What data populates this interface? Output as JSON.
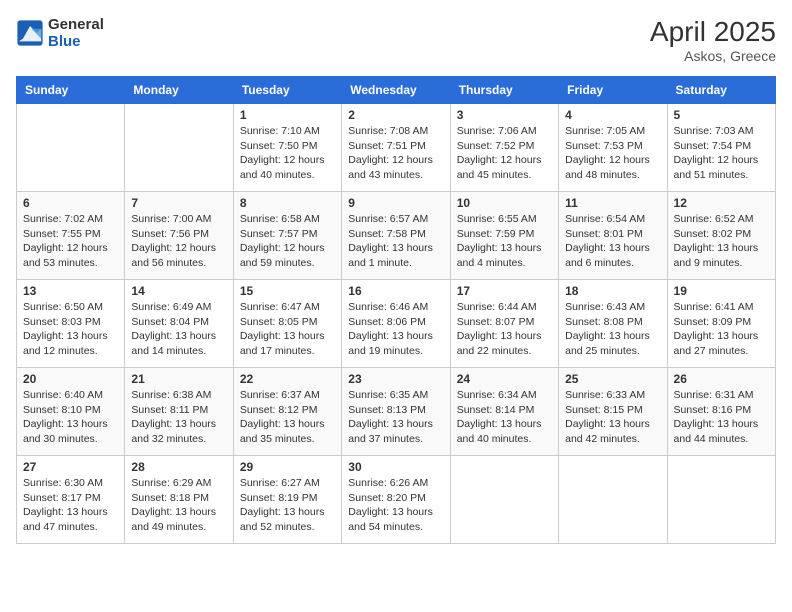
{
  "header": {
    "logo_line1": "General",
    "logo_line2": "Blue",
    "month_year": "April 2025",
    "location": "Askos, Greece"
  },
  "weekdays": [
    "Sunday",
    "Monday",
    "Tuesday",
    "Wednesday",
    "Thursday",
    "Friday",
    "Saturday"
  ],
  "weeks": [
    [
      {
        "day": "",
        "info": ""
      },
      {
        "day": "",
        "info": ""
      },
      {
        "day": "1",
        "info": "Sunrise: 7:10 AM\nSunset: 7:50 PM\nDaylight: 12 hours and 40 minutes."
      },
      {
        "day": "2",
        "info": "Sunrise: 7:08 AM\nSunset: 7:51 PM\nDaylight: 12 hours and 43 minutes."
      },
      {
        "day": "3",
        "info": "Sunrise: 7:06 AM\nSunset: 7:52 PM\nDaylight: 12 hours and 45 minutes."
      },
      {
        "day": "4",
        "info": "Sunrise: 7:05 AM\nSunset: 7:53 PM\nDaylight: 12 hours and 48 minutes."
      },
      {
        "day": "5",
        "info": "Sunrise: 7:03 AM\nSunset: 7:54 PM\nDaylight: 12 hours and 51 minutes."
      }
    ],
    [
      {
        "day": "6",
        "info": "Sunrise: 7:02 AM\nSunset: 7:55 PM\nDaylight: 12 hours and 53 minutes."
      },
      {
        "day": "7",
        "info": "Sunrise: 7:00 AM\nSunset: 7:56 PM\nDaylight: 12 hours and 56 minutes."
      },
      {
        "day": "8",
        "info": "Sunrise: 6:58 AM\nSunset: 7:57 PM\nDaylight: 12 hours and 59 minutes."
      },
      {
        "day": "9",
        "info": "Sunrise: 6:57 AM\nSunset: 7:58 PM\nDaylight: 13 hours and 1 minute."
      },
      {
        "day": "10",
        "info": "Sunrise: 6:55 AM\nSunset: 7:59 PM\nDaylight: 13 hours and 4 minutes."
      },
      {
        "day": "11",
        "info": "Sunrise: 6:54 AM\nSunset: 8:01 PM\nDaylight: 13 hours and 6 minutes."
      },
      {
        "day": "12",
        "info": "Sunrise: 6:52 AM\nSunset: 8:02 PM\nDaylight: 13 hours and 9 minutes."
      }
    ],
    [
      {
        "day": "13",
        "info": "Sunrise: 6:50 AM\nSunset: 8:03 PM\nDaylight: 13 hours and 12 minutes."
      },
      {
        "day": "14",
        "info": "Sunrise: 6:49 AM\nSunset: 8:04 PM\nDaylight: 13 hours and 14 minutes."
      },
      {
        "day": "15",
        "info": "Sunrise: 6:47 AM\nSunset: 8:05 PM\nDaylight: 13 hours and 17 minutes."
      },
      {
        "day": "16",
        "info": "Sunrise: 6:46 AM\nSunset: 8:06 PM\nDaylight: 13 hours and 19 minutes."
      },
      {
        "day": "17",
        "info": "Sunrise: 6:44 AM\nSunset: 8:07 PM\nDaylight: 13 hours and 22 minutes."
      },
      {
        "day": "18",
        "info": "Sunrise: 6:43 AM\nSunset: 8:08 PM\nDaylight: 13 hours and 25 minutes."
      },
      {
        "day": "19",
        "info": "Sunrise: 6:41 AM\nSunset: 8:09 PM\nDaylight: 13 hours and 27 minutes."
      }
    ],
    [
      {
        "day": "20",
        "info": "Sunrise: 6:40 AM\nSunset: 8:10 PM\nDaylight: 13 hours and 30 minutes."
      },
      {
        "day": "21",
        "info": "Sunrise: 6:38 AM\nSunset: 8:11 PM\nDaylight: 13 hours and 32 minutes."
      },
      {
        "day": "22",
        "info": "Sunrise: 6:37 AM\nSunset: 8:12 PM\nDaylight: 13 hours and 35 minutes."
      },
      {
        "day": "23",
        "info": "Sunrise: 6:35 AM\nSunset: 8:13 PM\nDaylight: 13 hours and 37 minutes."
      },
      {
        "day": "24",
        "info": "Sunrise: 6:34 AM\nSunset: 8:14 PM\nDaylight: 13 hours and 40 minutes."
      },
      {
        "day": "25",
        "info": "Sunrise: 6:33 AM\nSunset: 8:15 PM\nDaylight: 13 hours and 42 minutes."
      },
      {
        "day": "26",
        "info": "Sunrise: 6:31 AM\nSunset: 8:16 PM\nDaylight: 13 hours and 44 minutes."
      }
    ],
    [
      {
        "day": "27",
        "info": "Sunrise: 6:30 AM\nSunset: 8:17 PM\nDaylight: 13 hours and 47 minutes."
      },
      {
        "day": "28",
        "info": "Sunrise: 6:29 AM\nSunset: 8:18 PM\nDaylight: 13 hours and 49 minutes."
      },
      {
        "day": "29",
        "info": "Sunrise: 6:27 AM\nSunset: 8:19 PM\nDaylight: 13 hours and 52 minutes."
      },
      {
        "day": "30",
        "info": "Sunrise: 6:26 AM\nSunset: 8:20 PM\nDaylight: 13 hours and 54 minutes."
      },
      {
        "day": "",
        "info": ""
      },
      {
        "day": "",
        "info": ""
      },
      {
        "day": "",
        "info": ""
      }
    ]
  ]
}
